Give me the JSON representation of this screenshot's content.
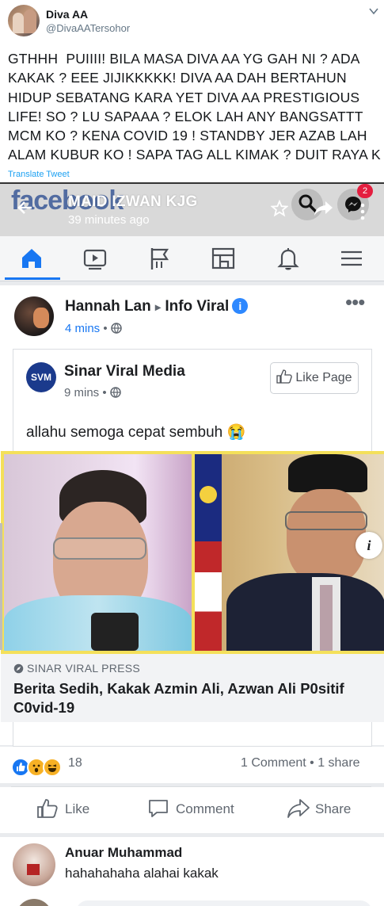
{
  "tweet": {
    "display_name": "Diva AA",
    "handle": "@DivaAATersohor",
    "text": "GTHHH  PUIIII! BILA MASA DIVA AA YG GAH NI ? ADA\nKAKAK ? EEE JIJIKKKKK! DIVA AA DAH BERTAHUN\nHIDUP SEBATANG KARA YET DIVA AA PRESTIGIOUS\nLIFE! SO ? LU SAPAAA ? ELOK LAH ANY BANGSATTT\nMCM KO ? KENA COVID 19 ! STANDBY JER AZAB LAH\nALAM KUBUR KO ! SAPA TAG ALL KIMAK ? DUIT RAYA K",
    "translate_label": "Translate Tweet",
    "menu_icon": "chevron-down-icon"
  },
  "fb": {
    "logo_text": "facebook",
    "header": {
      "page_name": "MAID IZWAN KJG",
      "time": "39 minutes ago",
      "messenger_badge": "2"
    },
    "post": {
      "poster": "Hannah Lan",
      "arrow": "▸",
      "group": "Info Viral",
      "time": "4 mins",
      "more": "•••",
      "shared": {
        "page_initials": "SVM",
        "page_name": "Sinar Viral Media",
        "time": "9 mins",
        "like_page_label": "Like Page",
        "text": "allahu semoga cepat sembuh 😭",
        "link_source": "SINAR VIRAL PRESS",
        "link_title": "Berita Sedih, Kakak Azmin Ali, Azwan Ali P0sitif C0vid-19",
        "info_icon": "i"
      },
      "reaction_count": "18",
      "comments_shares": "1 Comment • 1 share",
      "actions": {
        "like": "Like",
        "comment": "Comment",
        "share": "Share"
      }
    },
    "comment": {
      "name": "Anuar Muhammad",
      "text": "hahahahaha alahai kakak"
    }
  },
  "colors": {
    "fb_blue": "#1877f2",
    "twitter_blue": "#1da1f2",
    "badge_red": "#e41e3f",
    "image_border": "#f4e05a"
  }
}
